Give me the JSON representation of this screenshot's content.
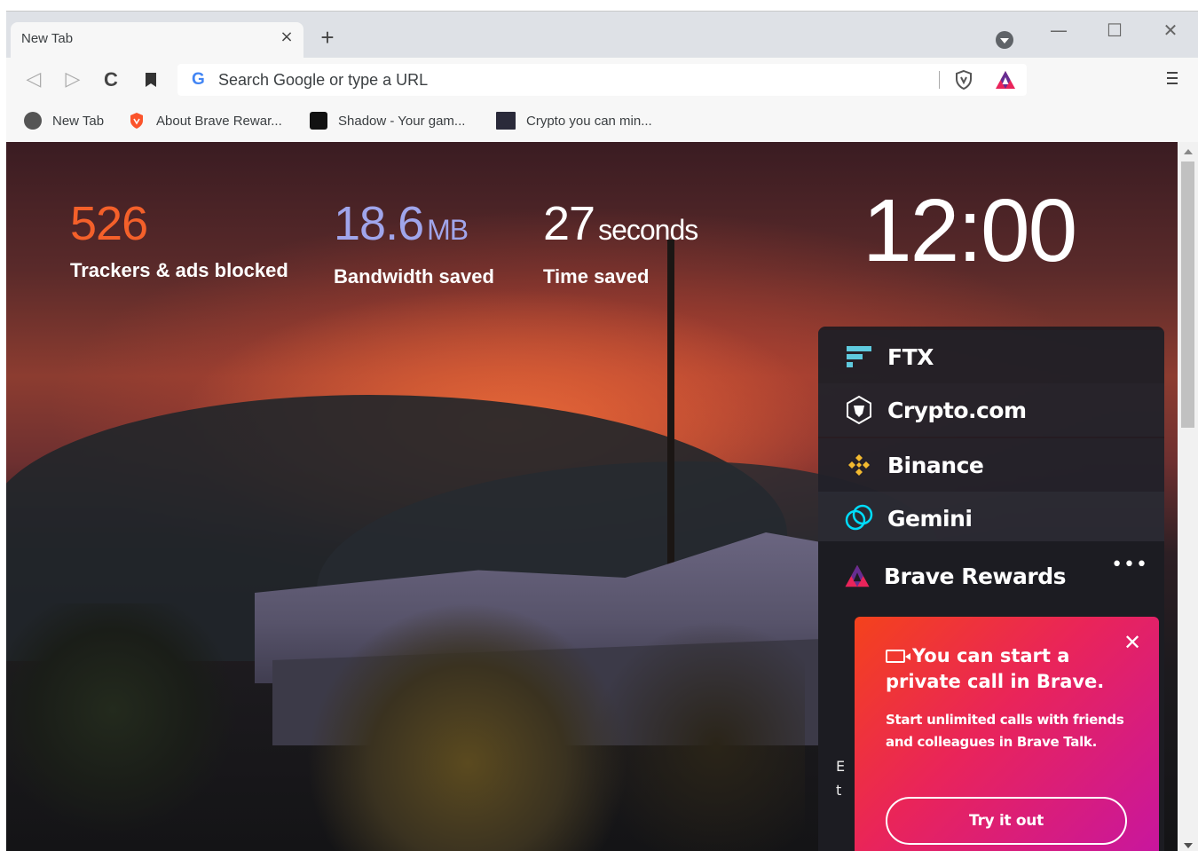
{
  "tab": {
    "title": "New Tab",
    "close": "×"
  },
  "tabstrip": {
    "new_tab": "+"
  },
  "window_controls": {
    "minimize": "—",
    "maximize": "☐",
    "close": "✕"
  },
  "toolbar": {
    "back": "◁",
    "forward": "▷",
    "reload": "C",
    "omnibox_placeholder": "Search Google or type a URL",
    "search_engine_icon": "G"
  },
  "bookmarks": [
    {
      "label": "New Tab",
      "icon": "globe-icon"
    },
    {
      "label": "About Brave Rewar...",
      "icon": "brave-lion-icon"
    },
    {
      "label": "Shadow - Your gam...",
      "icon": "shadow-icon"
    },
    {
      "label": "Crypto you can min...",
      "icon": "bnc-icon"
    }
  ],
  "stats": {
    "trackers": {
      "value": "526",
      "label": "Trackers & ads blocked",
      "color": "#f4602a"
    },
    "bandwidth": {
      "value": "18.6",
      "unit": "MB",
      "label": "Bandwidth saved",
      "color": "#a0a5eb"
    },
    "time": {
      "value": "27",
      "unit": "seconds",
      "label": "Time saved",
      "color": "#ffffff"
    }
  },
  "clock": "12:00",
  "widgets": {
    "ftx": "FTX",
    "crypto": "Crypto.com",
    "binance": "Binance",
    "gemini": "Gemini",
    "rewards": {
      "title": "Brave Rewards",
      "more": "•••",
      "body_partial_1": "E",
      "body_partial_2": "t"
    }
  },
  "promo": {
    "title": "You can start a private call in Brave.",
    "description": "Start unlimited calls with friends and colleagues in Brave Talk.",
    "button": "Try it out",
    "close": "✕"
  },
  "colors": {
    "accent_orange": "#f4602a",
    "bandwidth_blue": "#a0a5eb",
    "promo_start": "#f4421c",
    "promo_end": "#c8169e"
  }
}
